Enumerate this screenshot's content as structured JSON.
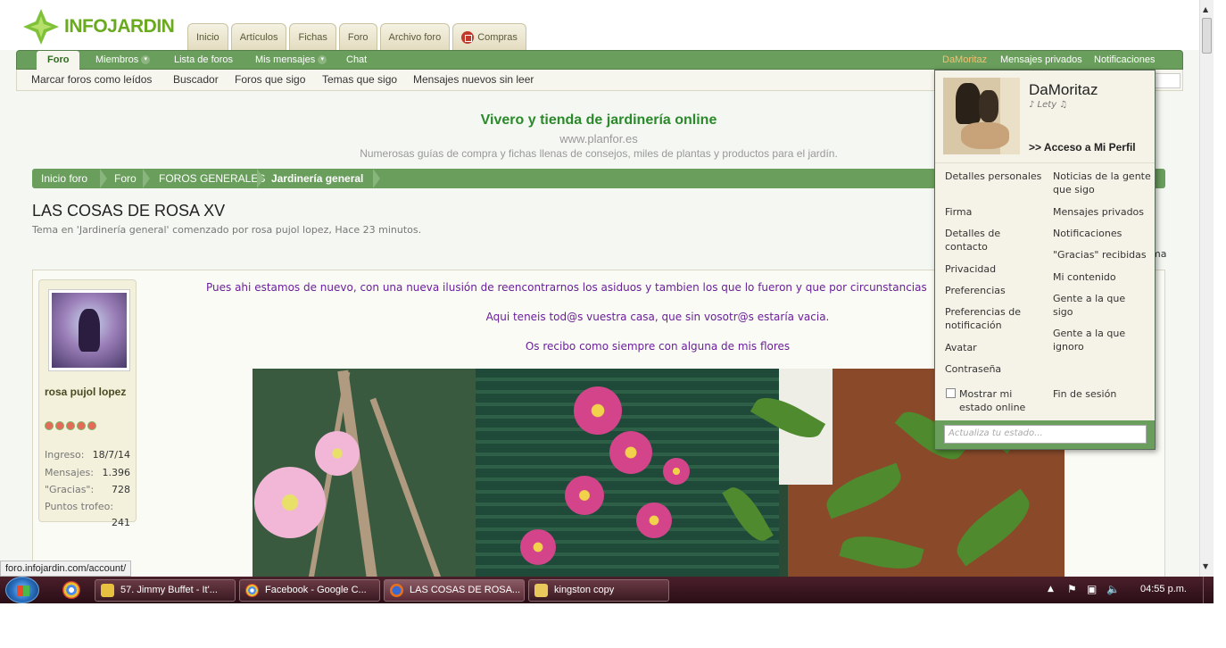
{
  "site": {
    "logo_text": "INFOJARDIN",
    "top_tabs": [
      "Inicio",
      "Artículos",
      "Fichas",
      "Foro",
      "Archivo foro",
      "Compras"
    ]
  },
  "navbar": {
    "foro": "Foro",
    "miembros": "Miembros",
    "lista_foros": "Lista de foros",
    "mis_mensajes": "Mis mensajes",
    "chat": "Chat",
    "user": "DaMoritaz",
    "mensajes_privados": "Mensajes privados",
    "notificaciones": "Notificaciones"
  },
  "subnav": {
    "marcar": "Marcar foros como leídos",
    "buscador": "Buscador",
    "foros_sigo": "Foros que sigo",
    "temas_sigo": "Temas que sigo",
    "nuevos": "Mensajes nuevos sin leer"
  },
  "promo": {
    "title": "Vivero y tienda de jardinería online",
    "url": "www.planfor.es",
    "desc": "Numerosas guías de compra y fichas llenas de consejos, miles de plantas y productos para el jardín."
  },
  "breadcrumb": [
    "Inicio foro",
    "Foro",
    "FOROS GENERALES",
    "Jardinería general"
  ],
  "thread": {
    "title": "LAS COSAS DE ROSA XV",
    "meta": "Tema en 'Jardinería general' comenzado por rosa pujol lopez, Hace 23 minutos.",
    "right_fragment": "ma"
  },
  "post": {
    "author": "rosa pujol lopez",
    "stats": [
      {
        "label": "Ingreso:",
        "value": "18/7/14"
      },
      {
        "label": "Mensajes:",
        "value": "1.396"
      },
      {
        "label": "\"Gracias\":",
        "value": "728"
      },
      {
        "label": "Puntos trofeo:",
        "value": "241"
      }
    ],
    "lines": [
      "Pues ahi estamos de nuevo, con una nueva ilusión de reencontrarnos los asiduos y tambien los que lo fueron y que por circunstancias",
      "Aqui teneis tod@s vuestra casa, que sin vosotr@s estaría vacia.",
      "Os recibo como siempre con alguna de mis flores"
    ]
  },
  "dropdown": {
    "name": "DaMoritaz",
    "status": "♪ Lety ♫",
    "profile": ">> Acceso a Mi Perfil",
    "left_links": [
      "Detalles personales",
      "Firma",
      "Detalles de contacto",
      "Privacidad",
      "Preferencias",
      "Preferencias de notificación",
      "Avatar",
      "Contraseña"
    ],
    "right_links": [
      "Noticias de la gente que sigo",
      "Mensajes privados",
      "Notificaciones",
      "\"Gracias\" recibidas",
      "Mi contenido",
      "Gente a la que sigo",
      "Gente a la que ignoro"
    ],
    "online_label": "Mostrar mi estado online",
    "logout": "Fin de sesión",
    "status_placeholder": "Actualiza tu estado..."
  },
  "statusbar": {
    "url": "foro.infojardin.com/account/"
  },
  "taskbar": {
    "buttons": [
      "57. Jimmy Buffet - It'...",
      "Facebook - Google C...",
      "LAS COSAS DE ROSA...",
      "kingston copy"
    ],
    "clock": "04:55 p.m."
  },
  "colors": {
    "nav_green": "#6a9e5c",
    "post_text": "#6a1f9a",
    "promo_green": "#2a8a2a",
    "user_orange": "#f3c070"
  }
}
